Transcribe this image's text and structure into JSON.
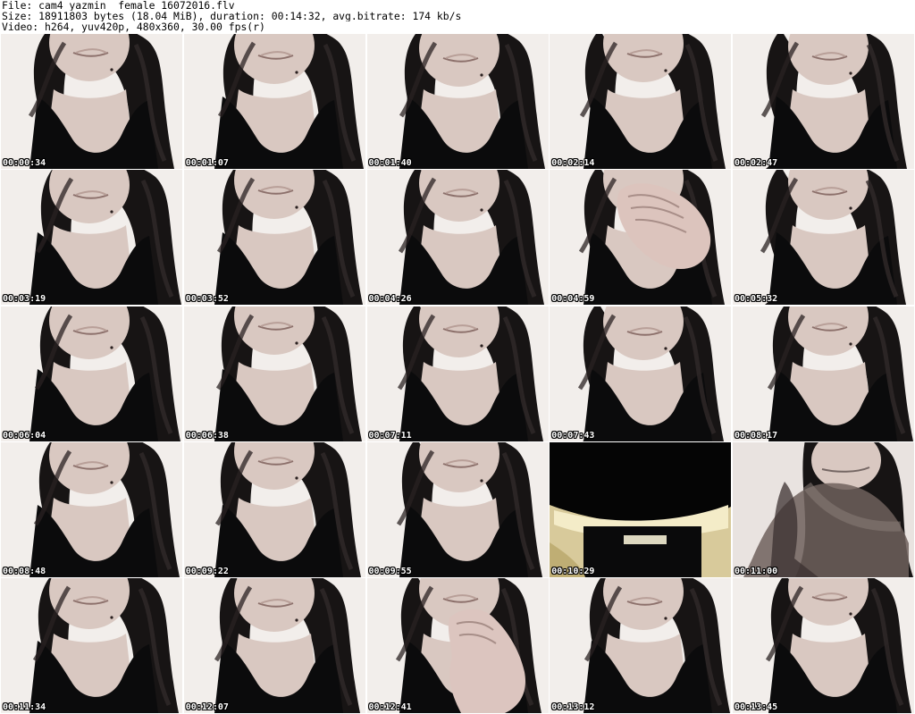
{
  "header": {
    "file_line": "File: cam4_yazmin__female_16072016.flv",
    "size_line": "Size: 18911803 bytes (18.04 MiB), duration: 00:14:32, avg.bitrate: 174 kb/s",
    "video_line": "Video: h264, yuv420p, 480x360, 30.00 fps(r)"
  },
  "thumbnails": [
    {
      "timestamp": "00:00:34",
      "scene": "portrait",
      "variant": 0
    },
    {
      "timestamp": "00:01:07",
      "scene": "portrait",
      "variant": 1
    },
    {
      "timestamp": "00:01:40",
      "scene": "portrait",
      "variant": 2
    },
    {
      "timestamp": "00:02:14",
      "scene": "portrait",
      "variant": 3
    },
    {
      "timestamp": "00:02:47",
      "scene": "portrait",
      "variant": 4
    },
    {
      "timestamp": "00:03:19",
      "scene": "portrait",
      "variant": 5
    },
    {
      "timestamp": "00:03:52",
      "scene": "portrait",
      "variant": 6
    },
    {
      "timestamp": "00:04:26",
      "scene": "portrait",
      "variant": 7
    },
    {
      "timestamp": "00:04:59",
      "scene": "hand-at-mouth",
      "variant": 8
    },
    {
      "timestamp": "00:05:32",
      "scene": "portrait",
      "variant": 9
    },
    {
      "timestamp": "00:06:04",
      "scene": "portrait",
      "variant": 10
    },
    {
      "timestamp": "00:06:38",
      "scene": "portrait",
      "variant": 11
    },
    {
      "timestamp": "00:07:11",
      "scene": "portrait",
      "variant": 12
    },
    {
      "timestamp": "00:07:43",
      "scene": "portrait",
      "variant": 13
    },
    {
      "timestamp": "00:08:17",
      "scene": "portrait",
      "variant": 14
    },
    {
      "timestamp": "00:08:48",
      "scene": "portrait",
      "variant": 15
    },
    {
      "timestamp": "00:09:22",
      "scene": "portrait",
      "variant": 16
    },
    {
      "timestamp": "00:09:55",
      "scene": "portrait",
      "variant": 17
    },
    {
      "timestamp": "00:10:29",
      "scene": "dark-closeup",
      "variant": 18
    },
    {
      "timestamp": "00:11:00",
      "scene": "motion-blur",
      "variant": 19
    },
    {
      "timestamp": "00:11:34",
      "scene": "portrait",
      "variant": 20
    },
    {
      "timestamp": "00:12:07",
      "scene": "portrait",
      "variant": 21
    },
    {
      "timestamp": "00:12:41",
      "scene": "hand-at-chin",
      "variant": 22
    },
    {
      "timestamp": "00:13:12",
      "scene": "portrait",
      "variant": 23
    },
    {
      "timestamp": "00:13:45",
      "scene": "portrait",
      "variant": 24
    }
  ],
  "colors": {
    "page_background": "#ffffff",
    "header_text": "#000000",
    "timestamp_text": "#ffffff",
    "timestamp_outline": "#000000",
    "wall": "#e9e3e0",
    "skin": "#d9c8c1",
    "hair": "#171414",
    "top": "#0b0b0c"
  }
}
